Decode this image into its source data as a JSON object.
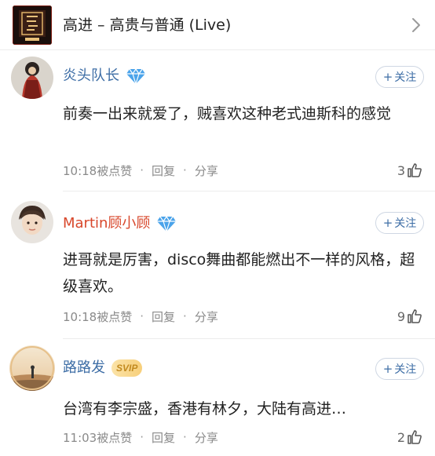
{
  "song": {
    "title": "高进 – 高贵与普通 (Live)",
    "cover_icon": "album-cover-icon",
    "chevron_icon": "chevron-right-icon"
  },
  "comments": [
    {
      "user": "炎头队长",
      "badge": "diamond-badge-icon",
      "follow_label": "关注",
      "text": "前奏一出来就爱了，贼喜欢这种老式迪斯科的感觉",
      "time_action": "10:18被点赞",
      "reply_label": "回复",
      "share_label": "分享",
      "likes": "3"
    },
    {
      "user": "Martin顾小顾",
      "badge": "diamond-badge-icon",
      "follow_label": "关注",
      "text": "进哥就是厉害，disco舞曲都能燃出不一样的风格，超级喜欢。",
      "time_action": "10:18被点赞",
      "reply_label": "回复",
      "share_label": "分享",
      "likes": "9"
    },
    {
      "user": "路路发",
      "badge_text": "SVIP",
      "follow_label": "关注",
      "text": "台湾有李宗盛，香港有林夕，大陆有高进…",
      "time_action": "11:03被点赞",
      "reply_label": "回复",
      "share_label": "分享",
      "likes": "2"
    }
  ],
  "colors": {
    "name_blue": "#3e6ea6",
    "name_red": "#d8472b",
    "meta_gray": "#8a8a8a",
    "divider": "#ececec"
  }
}
